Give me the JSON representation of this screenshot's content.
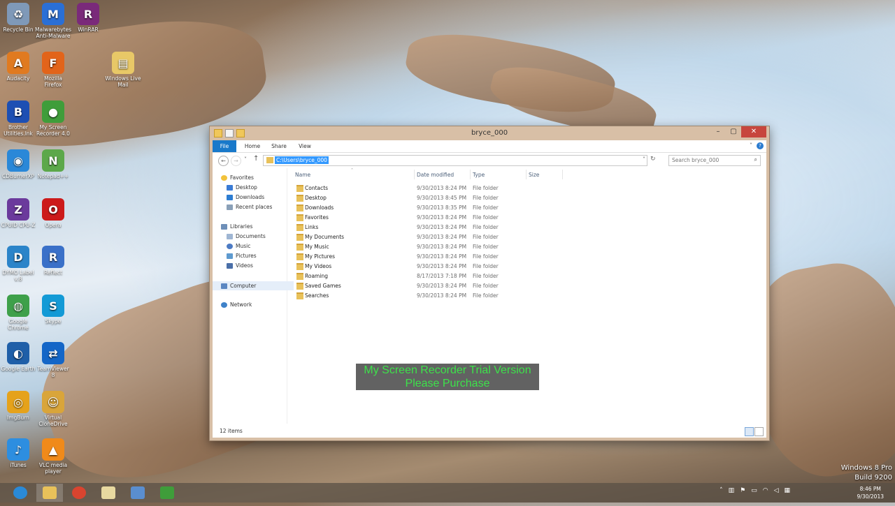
{
  "desktop": {
    "icons": [
      {
        "label": "Recycle Bin",
        "color": "#7f99b8",
        "glyph": "♻"
      },
      {
        "label": "Malwarebytes Anti-Malware",
        "color": "#2a6fd6",
        "glyph": "M"
      },
      {
        "label": "WinRAR",
        "color": "#7a2a7a",
        "glyph": "R"
      },
      {
        "label": "Audacity",
        "color": "#e07a20",
        "glyph": "A"
      },
      {
        "label": "Mozilla Firefox",
        "color": "#e2641a",
        "glyph": "F"
      },
      {
        "label": "Windows Live Mail",
        "color": "#e8c867",
        "glyph": "▤"
      },
      {
        "label": "Brother Utilities.lnk",
        "color": "#1d4fb3",
        "glyph": "B"
      },
      {
        "label": "My Screen Recorder 4.0",
        "color": "#3f9d3a",
        "glyph": "●"
      },
      {
        "label": "CDBurnerXP",
        "color": "#2a88d8",
        "glyph": "◉"
      },
      {
        "label": "Notepad++",
        "color": "#5ca84a",
        "glyph": "N"
      },
      {
        "label": "CPUID CPU-Z",
        "color": "#6b3a9c",
        "glyph": "Z"
      },
      {
        "label": "Opera",
        "color": "#cc1a1a",
        "glyph": "O"
      },
      {
        "label": "DYMO Label v.8",
        "color": "#2b84c9",
        "glyph": "D"
      },
      {
        "label": "Reflect",
        "color": "#3a70c8",
        "glyph": "R"
      },
      {
        "label": "Google Chrome",
        "color": "#3ea04a",
        "glyph": "◍"
      },
      {
        "label": "Skype",
        "color": "#139ad6",
        "glyph": "S"
      },
      {
        "label": "Google Earth",
        "color": "#1f5fa8",
        "glyph": "◐"
      },
      {
        "label": "TeamViewer 8",
        "color": "#1466c7",
        "glyph": "⇄"
      },
      {
        "label": "ImgBurn",
        "color": "#e5a21b",
        "glyph": "◎"
      },
      {
        "label": "Virtual CloneDrive",
        "color": "#d9a53a",
        "glyph": "☺"
      },
      {
        "label": "iTunes",
        "color": "#2d8ee0",
        "glyph": "♪"
      },
      {
        "label": "VLC media player",
        "color": "#f08a1a",
        "glyph": "▲"
      }
    ]
  },
  "window": {
    "title": "bryce_000",
    "ribbon_tabs": [
      "File",
      "Home",
      "Share",
      "View"
    ],
    "address_path": "C:\\Users\\bryce_000",
    "search_placeholder": "Search bryce_000",
    "nav": {
      "favorites": "Favorites",
      "favorites_items": [
        "Desktop",
        "Downloads",
        "Recent places"
      ],
      "libraries": "Libraries",
      "libraries_items": [
        "Documents",
        "Music",
        "Pictures",
        "Videos"
      ],
      "computer": "Computer",
      "network": "Network"
    },
    "columns": {
      "name": "Name",
      "date": "Date modified",
      "type": "Type",
      "size": "Size"
    },
    "files": [
      {
        "name": "Contacts",
        "date": "9/30/2013 8:24 PM",
        "type": "File folder"
      },
      {
        "name": "Desktop",
        "date": "9/30/2013 8:45 PM",
        "type": "File folder"
      },
      {
        "name": "Downloads",
        "date": "9/30/2013 8:35 PM",
        "type": "File folder"
      },
      {
        "name": "Favorites",
        "date": "9/30/2013 8:24 PM",
        "type": "File folder"
      },
      {
        "name": "Links",
        "date": "9/30/2013 8:24 PM",
        "type": "File folder"
      },
      {
        "name": "My Documents",
        "date": "9/30/2013 8:24 PM",
        "type": "File folder"
      },
      {
        "name": "My Music",
        "date": "9/30/2013 8:24 PM",
        "type": "File folder"
      },
      {
        "name": "My Pictures",
        "date": "9/30/2013 8:24 PM",
        "type": "File folder"
      },
      {
        "name": "My Videos",
        "date": "9/30/2013 8:24 PM",
        "type": "File folder"
      },
      {
        "name": "Roaming",
        "date": "8/17/2013 7:18 PM",
        "type": "File folder"
      },
      {
        "name": "Saved Games",
        "date": "9/30/2013 8:24 PM",
        "type": "File folder"
      },
      {
        "name": "Searches",
        "date": "9/30/2013 8:24 PM",
        "type": "File folder"
      }
    ],
    "status_count": "12 items"
  },
  "watermark": {
    "line1": "My Screen Recorder Trial Version",
    "line2": "Please Purchase"
  },
  "system": {
    "edition": "Windows 8 Pro",
    "build": "Build 9200"
  },
  "taskbar": {
    "time": "8:46 PM",
    "date": "9/30/2013"
  }
}
